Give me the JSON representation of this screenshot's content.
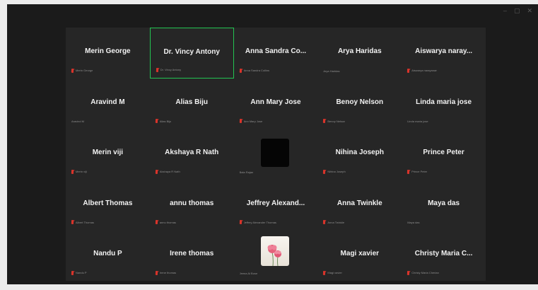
{
  "window": {
    "controls": [
      "–",
      "▢",
      "✕"
    ]
  },
  "participants": [
    {
      "name": "Merin George",
      "label": "Merin George",
      "muted": true
    },
    {
      "name": "Dr. Vincy Antony",
      "label": "Dr. Vincy Antony",
      "muted": true,
      "active": true
    },
    {
      "name": "Anna Sandra Co...",
      "label": "Anna Sandra Collins",
      "muted": true
    },
    {
      "name": "Arya Haridas",
      "label": "Arya Haridas",
      "muted": false
    },
    {
      "name": "Aiswarya naray...",
      "label": "Aiswarya narayanan",
      "muted": true
    },
    {
      "name": "Aravind M",
      "label": "Aravind M",
      "muted": false
    },
    {
      "name": "Alias Biju",
      "label": "Alias Biju",
      "muted": true
    },
    {
      "name": "Ann Mary Jose",
      "label": "Ann Mary Jose",
      "muted": true
    },
    {
      "name": "Benoy Nelson",
      "label": "Benoy Nelson",
      "muted": true
    },
    {
      "name": "Linda maria jose",
      "label": "Linda maria jose",
      "muted": false
    },
    {
      "name": "Merin viji",
      "label": "Merin viji",
      "muted": true
    },
    {
      "name": "Akshaya R Nath",
      "label": "Akshaya R Nath",
      "muted": true
    },
    {
      "name": "",
      "label": "Bala Rajan",
      "muted": false,
      "avatar": "black"
    },
    {
      "name": "Nihina Joseph",
      "label": "Nihina Joseph",
      "muted": true
    },
    {
      "name": "Prince Peter",
      "label": "Prince Peter",
      "muted": true
    },
    {
      "name": "Albert Thomas",
      "label": "Albert Thomas",
      "muted": true
    },
    {
      "name": "annu thomas",
      "label": "annu thomas",
      "muted": true
    },
    {
      "name": "Jeffrey Alexand...",
      "label": "Jeffrey Alexander Thomas",
      "muted": true
    },
    {
      "name": "Anna Twinkle",
      "label": "Anna Twinkle",
      "muted": true
    },
    {
      "name": "Maya das",
      "label": "Maya das",
      "muted": false
    },
    {
      "name": "Nandu P",
      "label": "Nandu P",
      "muted": true
    },
    {
      "name": "Irene thomas",
      "label": "Irene thomas",
      "muted": true
    },
    {
      "name": "",
      "label": "Jeena Al Bose",
      "muted": false,
      "avatar": "flower"
    },
    {
      "name": "Magi xavier",
      "label": "Magi xavier",
      "muted": true
    },
    {
      "name": "Christy Maria C...",
      "label": "Christy Maria Cherian",
      "muted": true
    }
  ],
  "colors": {
    "active_border": "#23c552",
    "mute": "#d9342b",
    "background": "#1b1b1b"
  }
}
